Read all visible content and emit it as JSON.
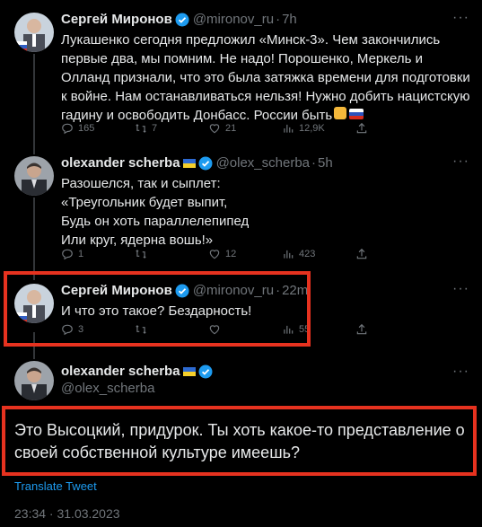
{
  "tweets": [
    {
      "name": "Сергей Миронов",
      "handle": "@mironov_ru",
      "time": "7h",
      "text": "Лукашенко сегодня предложил «Минск-3». Чем закончились первые два, мы помним. Не надо! Порошенко, Меркель и Олланд признали, что это была затяжка времени для подготовки к войне. Нам останавливаться нельзя! Нужно добить нацистскую гадину и освободить Донбасс. России быть",
      "replies": "165",
      "retweets": "7",
      "likes": "21",
      "views": "12,9K"
    },
    {
      "name": "olexander scherba",
      "handle": "@olex_scherba",
      "time": "5h",
      "text": "Разошелся, так и сыплет:\n«Треугольник будет выпит,\nБудь он хоть параллелепипед\nИли круг, ядерна вошь!»",
      "replies": "1",
      "retweets": "",
      "likes": "12",
      "views": "423"
    },
    {
      "name": "Сергей Миронов",
      "handle": "@mironov_ru",
      "time": "22m",
      "text": "И что это такое? Бездарность!",
      "replies": "3",
      "retweets": "",
      "likes": "",
      "views": "55"
    }
  ],
  "main": {
    "name": "olexander scherba",
    "handle": "@olex_scherba",
    "text": "Это Высоцкий, придурок. Ты хоть какое-то представление о своей собственной культуре имеешь?",
    "translate": "Translate Tweet",
    "timestamp": "23:34 · 31.03.2023"
  },
  "icons": {
    "more": "more-icon",
    "reply": "reply-icon",
    "retweet": "retweet-icon",
    "like": "heart-icon",
    "views": "views-icon",
    "share": "share-icon",
    "verified": "verified-badge-icon"
  },
  "colors": {
    "background": "#000000",
    "text": "#e7e9ea",
    "secondary": "#71767b",
    "accent": "#1d9bf0",
    "highlight": "#e6321f"
  },
  "separator": "·"
}
